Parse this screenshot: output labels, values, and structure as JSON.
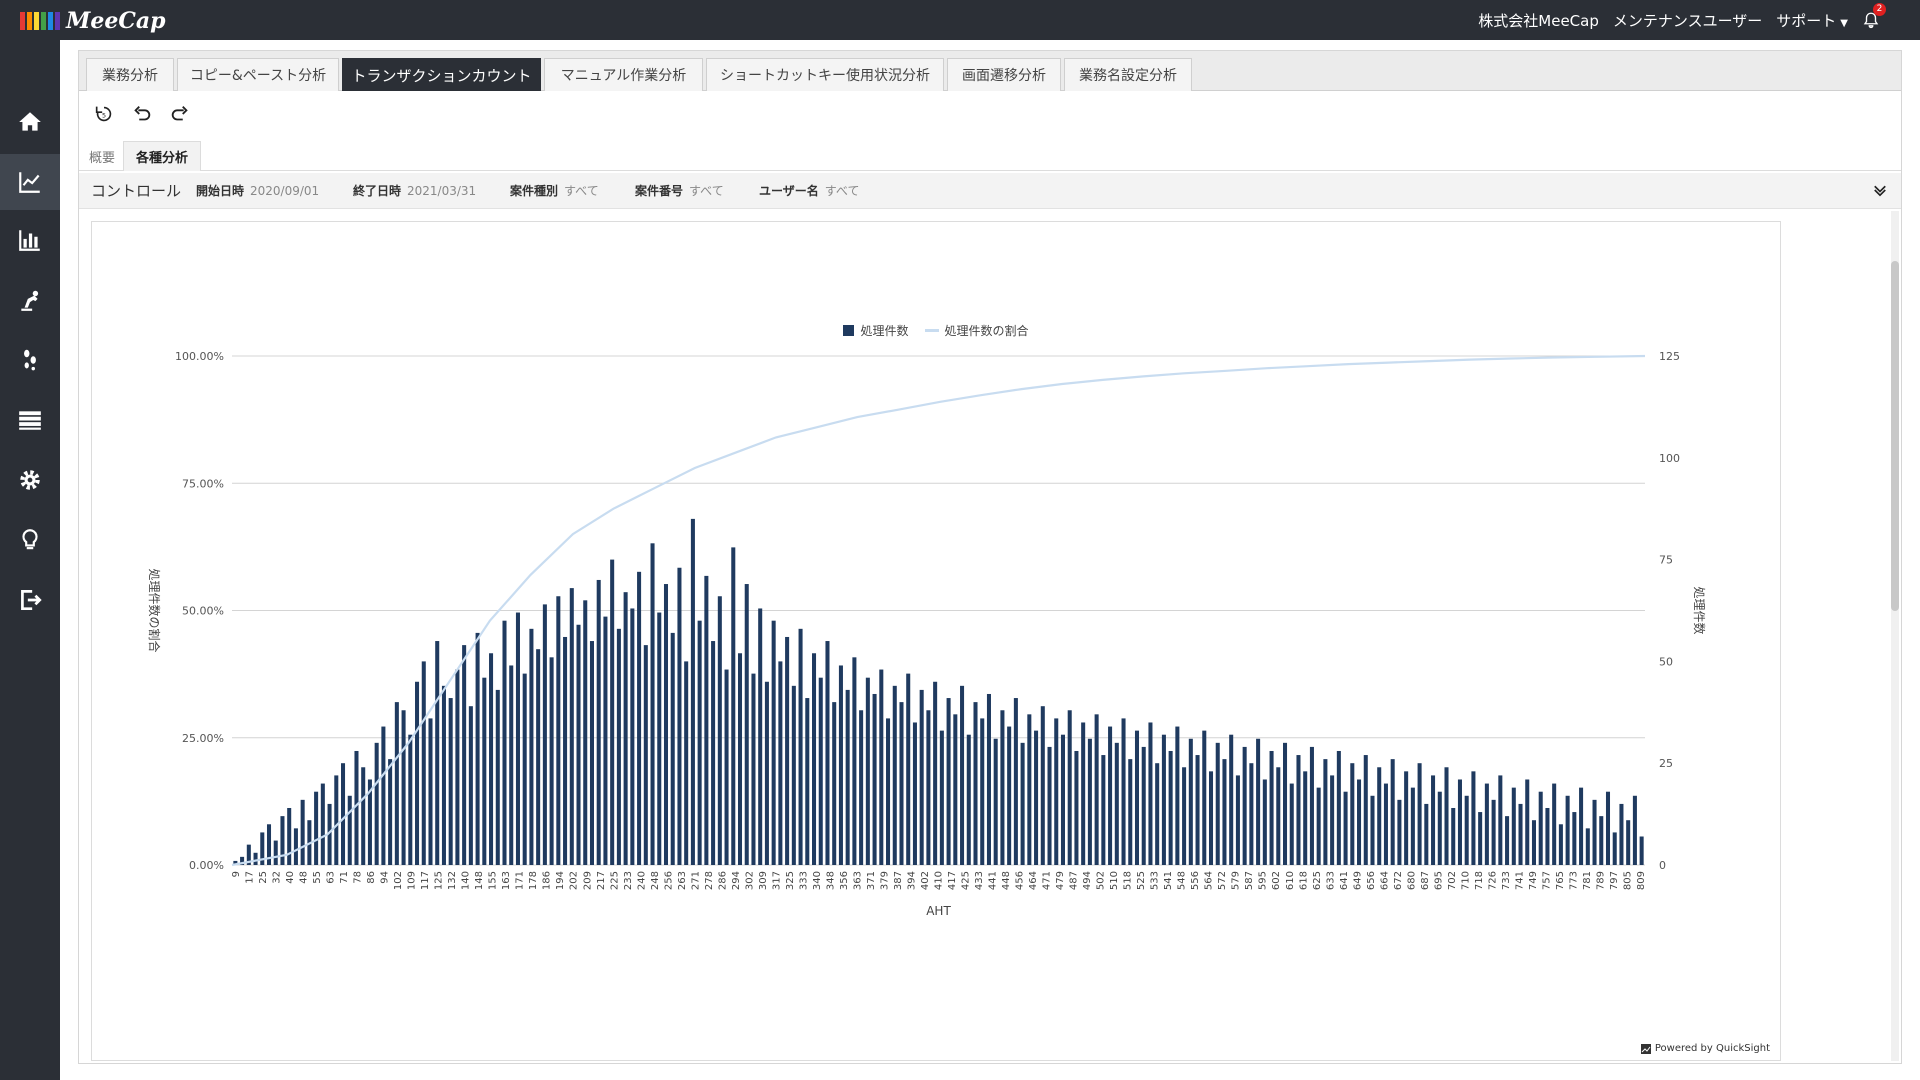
{
  "app": {
    "logo_text": "MeeCap",
    "logo_colors": [
      "#e53935",
      "#fb8c00",
      "#fdd835",
      "#43a047",
      "#1e88e5",
      "#5e35b1"
    ]
  },
  "header": {
    "company": "株式会社MeeCap",
    "user": "メンテナンスユーザー",
    "support": "サポート",
    "notification_count": "2"
  },
  "sidebar": {
    "items": [
      "home-icon",
      "trend-icon",
      "bar-chart-icon",
      "robot-arm-icon",
      "footprints-icon",
      "list-icon",
      "gear-icon",
      "lightbulb-icon",
      "logout-icon"
    ]
  },
  "tabs": [
    {
      "label": "業務分析"
    },
    {
      "label": "コピー&ペースト分析"
    },
    {
      "label": "トランザクションカウント",
      "active": true
    },
    {
      "label": "マニュアル作業分析"
    },
    {
      "label": "ショートカットキー使用状況分析"
    },
    {
      "label": "画面遷移分析"
    },
    {
      "label": "業務名設定分析"
    }
  ],
  "subtabs": [
    {
      "label": "概要"
    },
    {
      "label": "各種分析",
      "active": true
    }
  ],
  "controls": {
    "title": "コントロール",
    "items": [
      {
        "label": "開始日時",
        "value": "2020/09/01"
      },
      {
        "label": "終了日時",
        "value": "2021/03/31"
      },
      {
        "label": "案件種別",
        "value": "すべて"
      },
      {
        "label": "案件番号",
        "value": "すべて"
      },
      {
        "label": "ユーザー名",
        "value": "すべて"
      }
    ]
  },
  "footer": {
    "powered_by": "Powered by QuickSight"
  },
  "colors": {
    "bar": "#1f3a5f",
    "line": "#c8dcf0",
    "accent": "#2b2f36"
  },
  "chart_data": {
    "type": "bar",
    "xlabel": "AHT",
    "ylabel_left": "処理件数の割合",
    "ylabel_right": "処理件数",
    "legend": [
      {
        "name": "処理件数",
        "kind": "bar"
      },
      {
        "name": "処理件数の割合",
        "kind": "line"
      }
    ],
    "legend_position": "top-center",
    "left_ticks": [
      "0.00%",
      "25.00%",
      "50.00%",
      "75.00%",
      "100.00%"
    ],
    "right_ticks": [
      "0",
      "25",
      "50",
      "75",
      "100",
      "125"
    ],
    "y_right_lim": [
      0,
      125
    ],
    "y_left_lim": [
      0,
      100
    ],
    "x_tick_labels": [
      "9",
      "17",
      "25",
      "32",
      "40",
      "48",
      "55",
      "63",
      "71",
      "78",
      "86",
      "94",
      "102",
      "109",
      "117",
      "125",
      "132",
      "140",
      "148",
      "155",
      "163",
      "171",
      "178",
      "186",
      "194",
      "202",
      "209",
      "217",
      "225",
      "233",
      "240",
      "248",
      "256",
      "263",
      "271",
      "278",
      "286",
      "294",
      "302",
      "309",
      "317",
      "325",
      "333",
      "340",
      "348",
      "356",
      "363",
      "371",
      "379",
      "387",
      "394",
      "402",
      "410",
      "417",
      "425",
      "433",
      "441",
      "448",
      "456",
      "464",
      "471",
      "479",
      "487",
      "494",
      "502",
      "510",
      "518",
      "525",
      "533",
      "541",
      "548",
      "556",
      "564",
      "572",
      "579",
      "587",
      "595",
      "602",
      "610",
      "618",
      "625",
      "633",
      "641",
      "649",
      "656",
      "664",
      "672",
      "680",
      "687",
      "695",
      "702",
      "710",
      "718",
      "726",
      "733",
      "741",
      "749",
      "757",
      "765",
      "773",
      "781",
      "789",
      "797",
      "805",
      "809"
    ],
    "series": [
      {
        "name": "処理件数",
        "values": [
          1,
          2,
          5,
          3,
          8,
          10,
          6,
          12,
          14,
          9,
          16,
          11,
          18,
          20,
          15,
          22,
          25,
          17,
          28,
          24,
          21,
          30,
          34,
          26,
          40,
          38,
          32,
          45,
          50,
          36,
          55,
          44,
          41,
          48,
          54,
          39,
          57,
          46,
          52,
          43,
          60,
          49,
          62,
          47,
          58,
          53,
          64,
          51,
          66,
          56,
          68,
          59,
          65,
          55,
          70,
          61,
          75,
          58,
          67,
          63,
          72,
          54,
          79,
          62,
          69,
          57,
          73,
          50,
          85,
          60,
          71,
          55,
          66,
          48,
          78,
          52,
          69,
          47,
          63,
          45,
          60,
          50,
          56,
          44,
          58,
          41,
          52,
          46,
          55,
          40,
          49,
          43,
          51,
          38,
          46,
          42,
          48,
          36,
          44,
          40,
          47,
          35,
          43,
          38,
          45,
          33,
          41,
          37,
          44,
          32,
          40,
          36,
          42,
          31,
          38,
          34,
          41,
          30,
          37,
          33,
          39,
          29,
          36,
          32,
          38,
          28,
          35,
          31,
          37,
          27,
          34,
          30,
          36,
          26,
          33,
          29,
          35,
          25,
          32,
          28,
          34,
          24,
          31,
          27,
          33,
          23,
          30,
          26,
          32,
          22,
          29,
          25,
          31,
          21,
          28,
          24,
          30,
          20,
          27,
          23,
          29,
          19,
          26,
          22,
          28,
          18,
          25,
          21,
          27,
          17,
          24,
          20,
          26,
          16,
          23,
          19,
          25,
          15,
          22,
          18,
          24,
          14,
          21,
          17,
          23,
          13,
          20,
          16,
          22,
          12,
          19,
          15,
          21,
          11,
          18,
          14,
          20,
          10,
          17,
          13,
          19,
          9,
          16,
          12,
          18,
          8,
          15,
          11,
          17,
          7
        ]
      },
      {
        "name": "処理件数の割合",
        "points": [
          [
            9,
            0
          ],
          [
            40,
            2
          ],
          [
            63,
            6
          ],
          [
            86,
            14
          ],
          [
            109,
            24
          ],
          [
            132,
            36
          ],
          [
            155,
            48
          ],
          [
            178,
            57
          ],
          [
            202,
            65
          ],
          [
            225,
            70
          ],
          [
            248,
            74
          ],
          [
            271,
            78
          ],
          [
            294,
            81
          ],
          [
            317,
            84
          ],
          [
            340,
            86
          ],
          [
            363,
            88
          ],
          [
            387,
            89.5
          ],
          [
            410,
            91
          ],
          [
            433,
            92.3
          ],
          [
            456,
            93.5
          ],
          [
            479,
            94.5
          ],
          [
            502,
            95.3
          ],
          [
            525,
            96
          ],
          [
            548,
            96.6
          ],
          [
            572,
            97.1
          ],
          [
            595,
            97.6
          ],
          [
            618,
            98
          ],
          [
            641,
            98.4
          ],
          [
            664,
            98.7
          ],
          [
            687,
            99
          ],
          [
            710,
            99.3
          ],
          [
            733,
            99.5
          ],
          [
            757,
            99.7
          ],
          [
            781,
            99.85
          ],
          [
            809,
            100
          ]
        ]
      }
    ]
  }
}
